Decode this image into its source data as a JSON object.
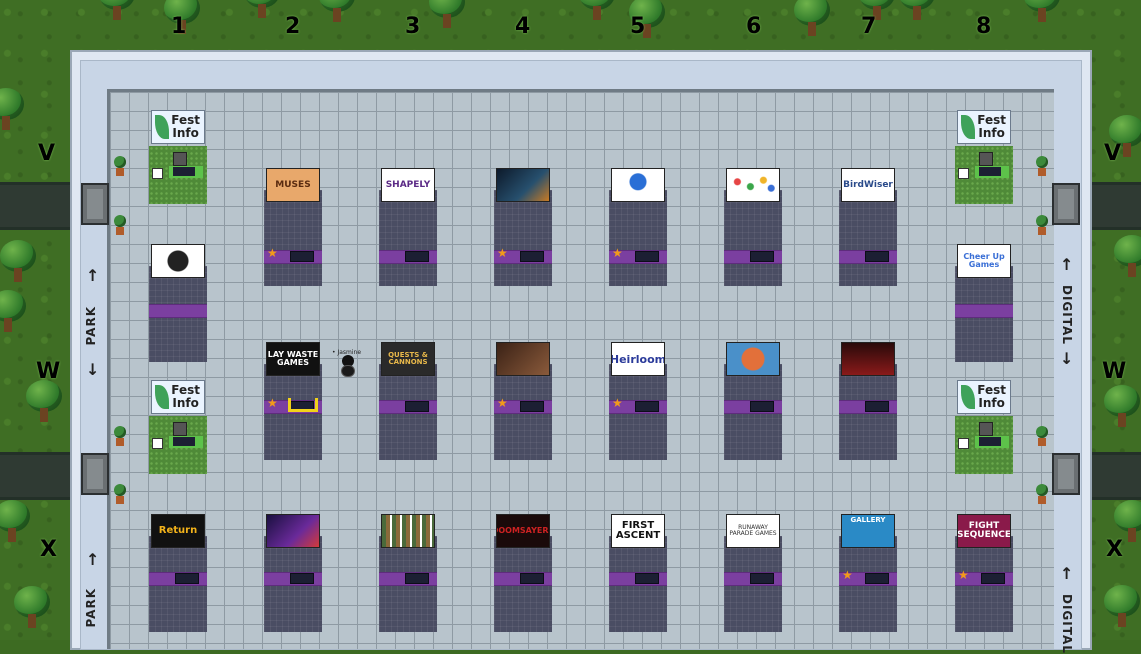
{
  "columns": [
    "1",
    "2",
    "3",
    "4",
    "5",
    "6",
    "7",
    "8"
  ],
  "rows": [
    "V",
    "W",
    "X"
  ],
  "side_labels": {
    "left": "PARK",
    "right": "DIGITAL"
  },
  "arrows": {
    "up": "↑",
    "down": "↓"
  },
  "avatar_name": "• Jasmine",
  "info_signs": {
    "line1": "Fest",
    "line2": "Info"
  },
  "booths": [
    {
      "id": "muses",
      "sign": "MUSES"
    },
    {
      "id": "shapely",
      "sign": "SHAPELY"
    },
    {
      "id": "dark-scene",
      "sign": ""
    },
    {
      "id": "blue-logo",
      "sign": ""
    },
    {
      "id": "dots",
      "sign": ""
    },
    {
      "id": "birdwiser",
      "sign": "BirdWiser"
    },
    {
      "id": "kiwi",
      "sign": ""
    },
    {
      "id": "cheer-up",
      "sign": "Cheer Up Games"
    },
    {
      "id": "lay-waste",
      "sign": "LAY WASTE GAMES"
    },
    {
      "id": "quests-cannons",
      "sign": "QUESTS & CANNONS"
    },
    {
      "id": "brown-scene",
      "sign": ""
    },
    {
      "id": "heirloom",
      "sign": "Heirloom"
    },
    {
      "id": "pizza",
      "sign": ""
    },
    {
      "id": "red-scene",
      "sign": ""
    },
    {
      "id": "return",
      "sign": "Return"
    },
    {
      "id": "wyrd",
      "sign": ""
    },
    {
      "id": "books",
      "sign": ""
    },
    {
      "id": "doomsayers",
      "sign": "DOOMSAYERS"
    },
    {
      "id": "first-ascent",
      "sign": "FIRST ASCENT"
    },
    {
      "id": "runaway",
      "sign": "RUNAWAY PARADE GAMES"
    },
    {
      "id": "gallery",
      "sign": "GALLERY"
    },
    {
      "id": "fight-sequence",
      "sign": "FIGHT SEQUENCE"
    }
  ],
  "colors": {
    "booth_bar": "#7b3fa0",
    "star": "#f29a1a",
    "floor": "#b8c4cc"
  },
  "icons": {
    "star": "star-icon",
    "plant": "potted-plant-icon",
    "tv": "tv-icon"
  }
}
